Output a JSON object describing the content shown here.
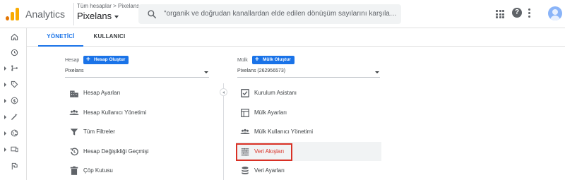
{
  "header": {
    "app_title": "Analytics",
    "breadcrumb": "Tüm hesaplar > Pixelans",
    "property_name": "Pixelans",
    "search_text": "\"organik ve doğrudan kanallardan elde edilen dönüşüm sayılarını karşılaşt...",
    "icons": [
      "apps-icon",
      "help-icon",
      "more-vert-icon",
      "account-avatar"
    ]
  },
  "leftnav": {
    "items": [
      "home-icon",
      "clock-icon",
      "customization-icon",
      "tag-icon",
      "dollar-icon",
      "wand-icon",
      "globe-icon",
      "screen-icon",
      "flag-icon"
    ]
  },
  "tabs": [
    {
      "label": "YÖNETİCİ",
      "active": true
    },
    {
      "label": "KULLANICI",
      "active": false
    }
  ],
  "account": {
    "label": "Hesap",
    "create_button": "Hesap Oluştur",
    "selected": "Pixelans",
    "items": [
      {
        "label": "Hesap Ayarları",
        "icon": "building-icon"
      },
      {
        "label": "Hesap Kullanıcı Yönetimi",
        "icon": "people-icon"
      },
      {
        "label": "Tüm Filtreler",
        "icon": "filter-icon"
      },
      {
        "label": "Hesap Değişikliği Geçmişi",
        "icon": "history-icon"
      },
      {
        "label": "Çöp Kutusu",
        "icon": "trash-icon"
      }
    ]
  },
  "property": {
    "label": "Mülk",
    "create_button": "Mülk Oluştur",
    "selected": "Pixelans (262956573)",
    "items": [
      {
        "label": "Kurulum Asistanı",
        "icon": "checkbox-icon"
      },
      {
        "label": "Mülk Ayarları",
        "icon": "property-icon"
      },
      {
        "label": "Mülk Kullanıcı Yönetimi",
        "icon": "people-icon"
      },
      {
        "label": "Veri Akışları",
        "icon": "data-streams-icon",
        "highlighted": true
      },
      {
        "label": "Veri Ayarları",
        "icon": "database-icon"
      }
    ]
  },
  "colors": {
    "accent": "#1a73e8",
    "highlight": "#d93025",
    "logo_orange": "#f9ab00"
  }
}
